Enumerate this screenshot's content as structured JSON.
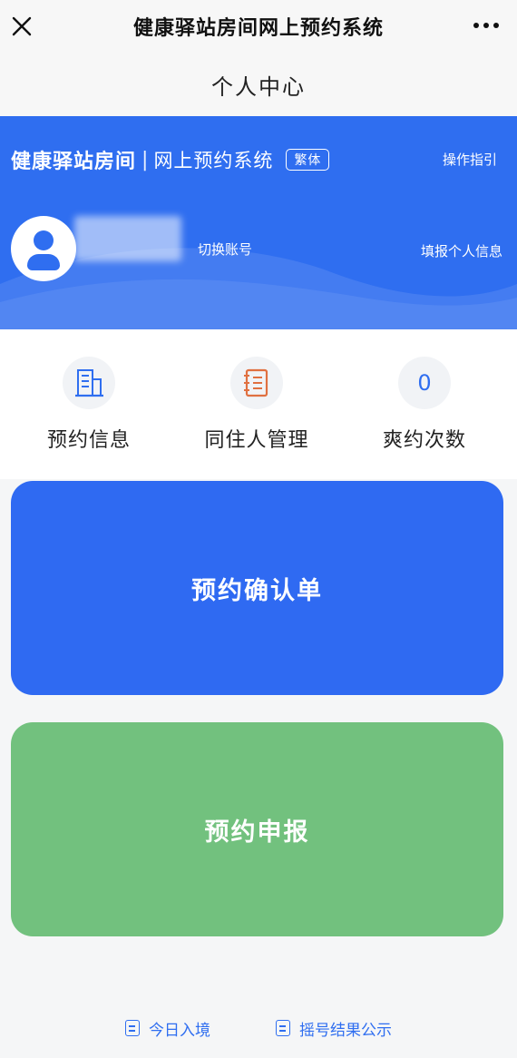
{
  "titlebar": {
    "title": "健康驿站房间网上预约系统"
  },
  "subheader": {
    "title": "个人中心"
  },
  "banner": {
    "brand_name": "健康驿站房间",
    "separator": "|",
    "system_name": "网上预约系统",
    "traditional_toggle": "繁体",
    "guide_link": "操作指引",
    "switch_account": "切换账号",
    "fill_info": "填报个人信息"
  },
  "stats": [
    {
      "label": "预约信息",
      "icon": "building-icon"
    },
    {
      "label": "同住人管理",
      "icon": "notebook-icon"
    },
    {
      "label": "爽约次数",
      "value": "0"
    }
  ],
  "buttons": {
    "confirm": "预约确认单",
    "apply": "预约申报"
  },
  "footer": {
    "links": [
      "今日入境",
      "摇号结果公示"
    ]
  },
  "colors": {
    "primary_blue": "#2f6ef0",
    "confirm_blue": "#2f6af2",
    "apply_green": "#72c17e",
    "orange_icon": "#e07040"
  }
}
